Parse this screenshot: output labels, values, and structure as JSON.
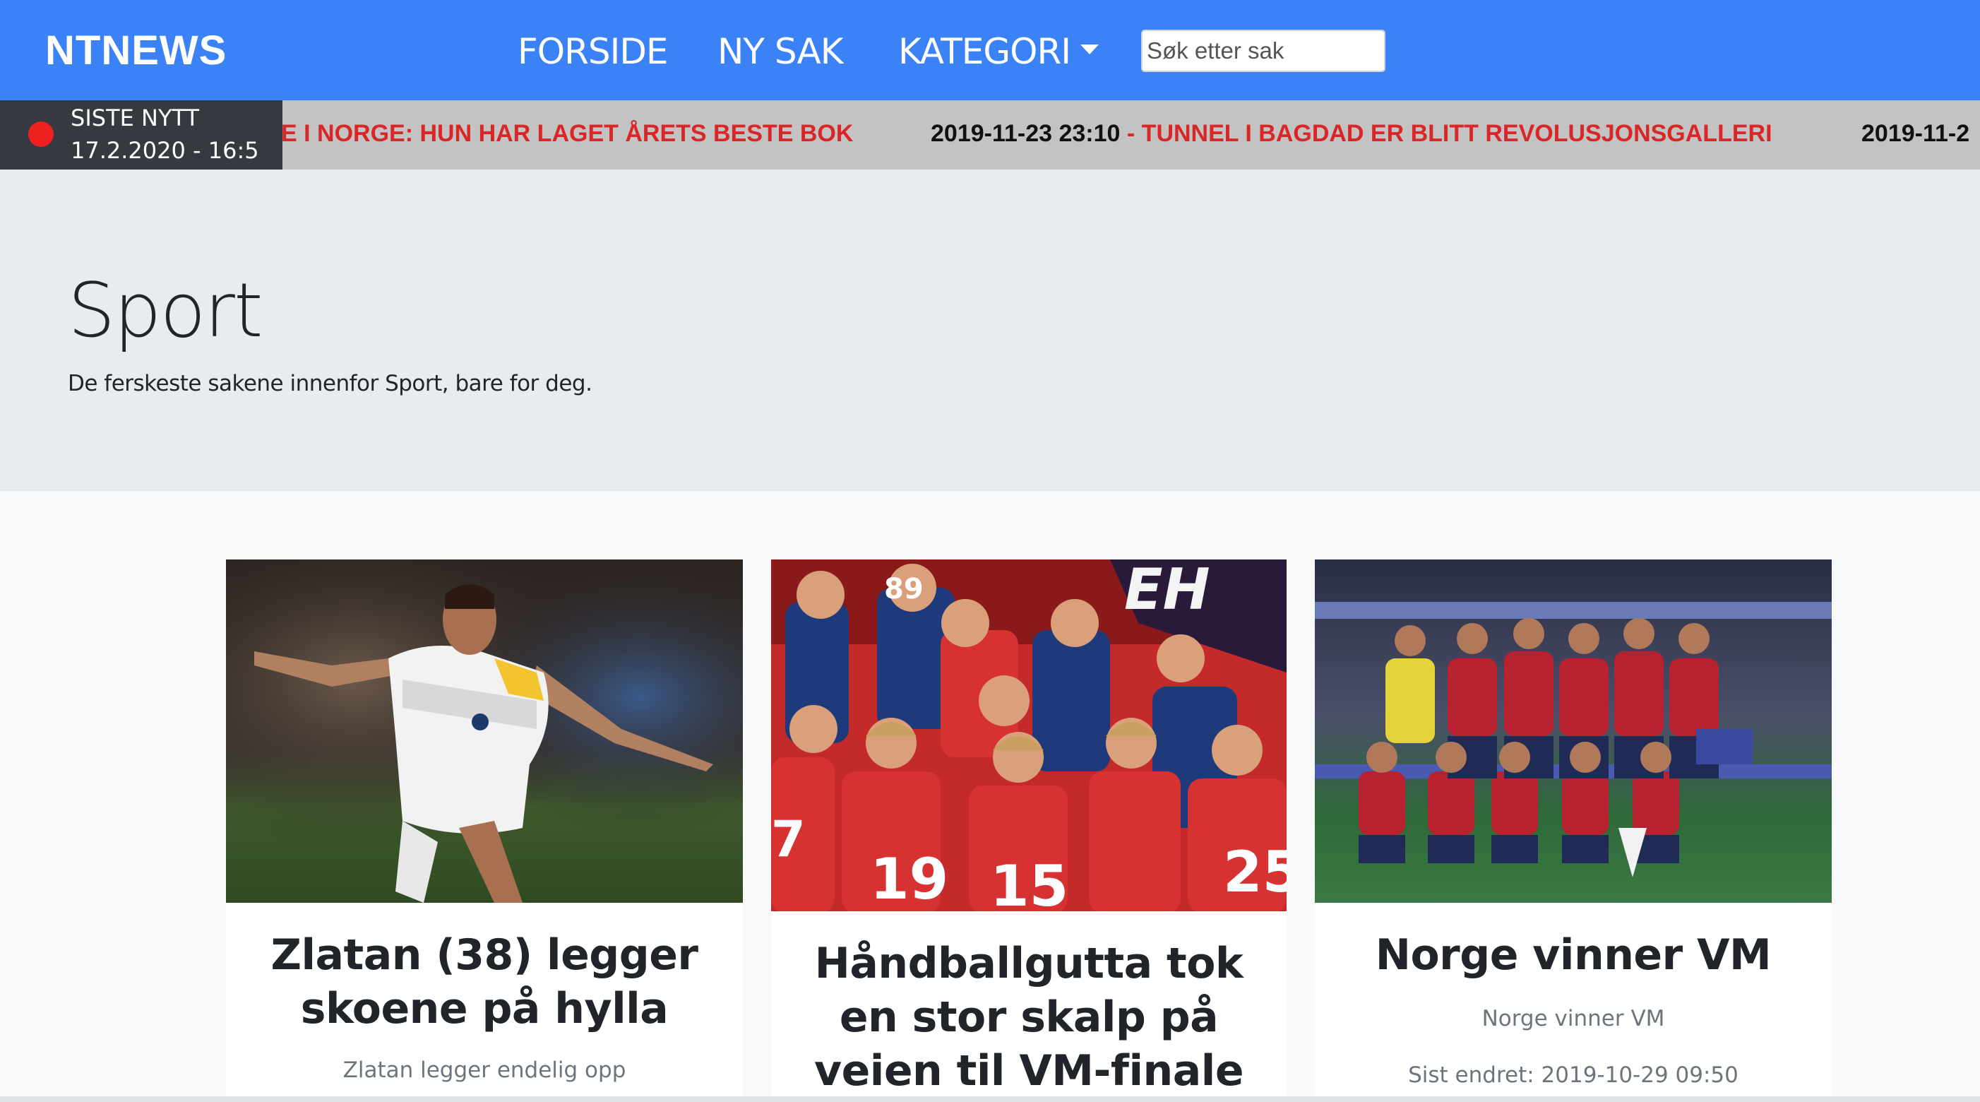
{
  "navbar": {
    "brand": "NTNEWS",
    "links": [
      "FORSIDE",
      "NY SAK",
      "KATEGORI"
    ],
    "search_placeholder": "Søk etter sak"
  },
  "ticker": {
    "title": "SISTE NYTT",
    "time": "17.2.2020 - 16:5",
    "items": [
      {
        "date": "",
        "headline": "E I NORGE: HUN HAR LAGET ÅRETS BESTE BOK"
      },
      {
        "date": "2019-11-23 23:10",
        "sep": " - ",
        "headline": "TUNNEL I BAGDAD ER BLITT REVOLUSJONSGALLERI"
      },
      {
        "date": "2019-11-2",
        "sep": "",
        "headline": ""
      }
    ]
  },
  "jumbotron": {
    "title": "Sport",
    "subtitle": "De ferskeste sakene innenfor Sport, bare for deg."
  },
  "cards": [
    {
      "title": "Zlatan (38) legger skoene på hylla",
      "text": "Zlatan legger endelig opp"
    },
    {
      "title": "Håndballgutta tok en stor skalp på veien til VM-finale"
    },
    {
      "title": "Norge vinner VM",
      "text": "Norge vinner VM",
      "meta": "Sist endret: 2019-10-29 09:50"
    }
  ],
  "colors": {
    "navbar": "#3b82f6",
    "ticker_bg": "#c3c3c3",
    "ticker_label_bg": "#343a40",
    "live_dot": "#ef2020",
    "headline_red": "#d92626",
    "jumbotron": "#e9ecef"
  },
  "icons": {
    "live": "red-dot-icon",
    "dropdown": "caret-down-icon"
  }
}
